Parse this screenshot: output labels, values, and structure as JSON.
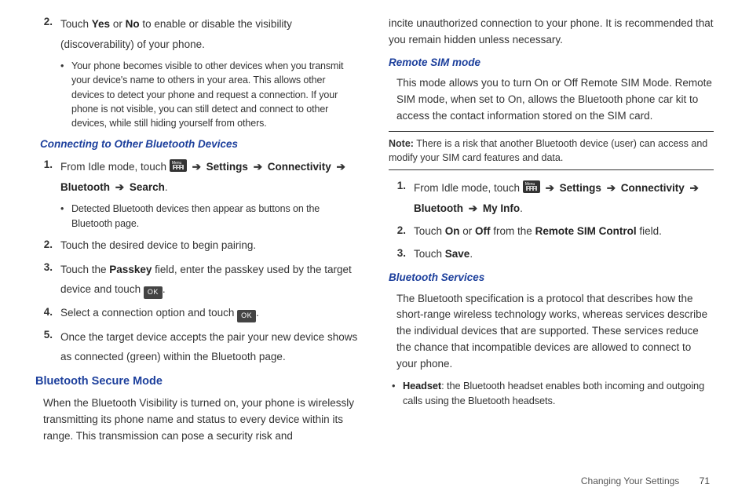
{
  "left": {
    "step2": {
      "num": "2.",
      "text_a": "Touch ",
      "yes": "Yes",
      "or": " or ",
      "no": "No",
      "text_b": " to enable or disable the visibility (discoverability) of your phone."
    },
    "bullet1": "Your phone becomes visible to other devices when you transmit your device's name to others in your area. This allows other devices to detect your phone and request a connection. If your phone is not visible, you can still detect and connect to other devices, while still hiding yourself from others.",
    "h_connect": "Connecting to Other Bluetooth Devices",
    "c1": {
      "num": "1.",
      "pre": "From Idle mode, touch ",
      "arrow": "➔",
      "settings": "Settings",
      "connectivity": "Connectivity",
      "bluetooth": "Bluetooth",
      "search": "Search"
    },
    "c1_bullet": "Detected Bluetooth devices then appear as buttons on the Bluetooth page.",
    "c2": {
      "num": "2.",
      "text": "Touch the desired device to begin pairing."
    },
    "c3": {
      "num": "3.",
      "a": "Touch the ",
      "passkey": "Passkey",
      "b": " field, enter the passkey used by the target device and touch ",
      "ok": "OK",
      "c": "."
    },
    "c4": {
      "num": "4.",
      "a": "Select a connection option and touch ",
      "ok": "OK",
      "b": "."
    },
    "c5": {
      "num": "5.",
      "text": "Once the target device accepts the pair your new device shows as connected (green) within the Bluetooth page."
    },
    "h_secure": "Bluetooth Secure Mode",
    "secure_para": "When the Bluetooth Visibility is turned on, your phone is wirelessly transmitting its phone name and status to every device within its range. This transmission can pose a security risk and"
  },
  "right": {
    "secure_cont": "incite unauthorized connection to your phone. It is recommended that you remain hidden unless necessary.",
    "h_remote": "Remote SIM mode",
    "remote_para": "This mode allows you to turn On or Off Remote SIM Mode. Remote SIM mode, when set to On, allows the Bluetooth phone car kit to access the contact information stored on the SIM card.",
    "note_label": "Note:",
    "note_text": " There is a risk that another Bluetooth device (user) can access and modify your SIM card features and data.",
    "r1": {
      "num": "1.",
      "pre": "From Idle mode, touch ",
      "arrow": "➔",
      "settings": "Settings",
      "connectivity": "Connectivity",
      "bluetooth": "Bluetooth",
      "myinfo": "My Info"
    },
    "r2": {
      "num": "2.",
      "a": "Touch ",
      "on": "On",
      "or": " or ",
      "off": "Off",
      "b": " from the ",
      "field": "Remote SIM Control",
      "c": " field."
    },
    "r3": {
      "num": "3.",
      "a": "Touch ",
      "save": "Save",
      "b": "."
    },
    "h_services": "Bluetooth Services",
    "services_para": "The Bluetooth specification is a protocol that describes how the short-range wireless technology works, whereas services describe the individual devices that are supported. These services reduce the chance that incompatible devices are allowed to connect to your phone.",
    "services_bullet_label": "Headset",
    "services_bullet_text": ": the Bluetooth headset enables both incoming and outgoing calls using the Bluetooth headsets."
  },
  "footer": {
    "section": "Changing Your Settings",
    "page": "71"
  }
}
